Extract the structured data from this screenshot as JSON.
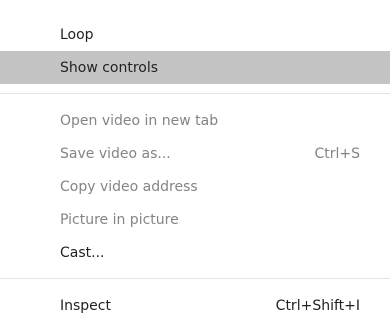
{
  "menu": {
    "items": [
      {
        "label": "Loop",
        "shortcut": "",
        "state": "enabled"
      },
      {
        "label": "Show controls",
        "shortcut": "",
        "state": "highlighted"
      },
      {
        "label": "Open video in new tab",
        "shortcut": "",
        "state": "disabled"
      },
      {
        "label": "Save video as...",
        "shortcut": "Ctrl+S",
        "state": "disabled"
      },
      {
        "label": "Copy video address",
        "shortcut": "",
        "state": "disabled"
      },
      {
        "label": "Picture in picture",
        "shortcut": "",
        "state": "disabled"
      },
      {
        "label": "Cast...",
        "shortcut": "",
        "state": "enabled"
      },
      {
        "label": "Inspect",
        "shortcut": "Ctrl+Shift+I",
        "state": "enabled"
      }
    ]
  },
  "colors": {
    "highlight": "#c4c4c4",
    "enabled_text": "#222222",
    "disabled_text": "#848484",
    "separator": "#e3e3e3"
  }
}
